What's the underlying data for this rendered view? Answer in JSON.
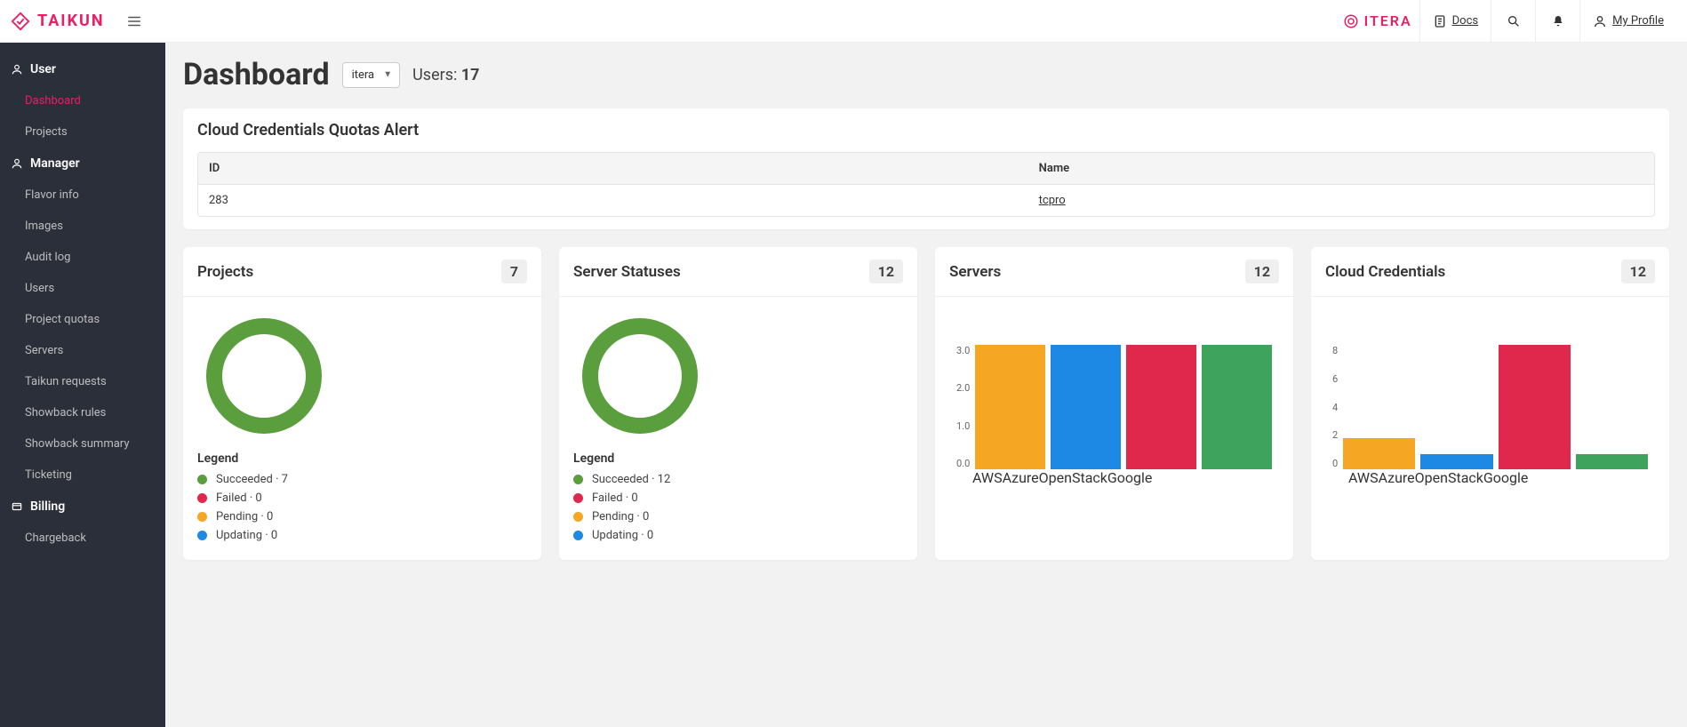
{
  "brand": {
    "name": "TAIKUN"
  },
  "header": {
    "org_label": "ITERA",
    "docs": "Docs",
    "profile": "My Profile"
  },
  "sidebar": {
    "user_section": "User",
    "manager_section": "Manager",
    "billing_section": "Billing",
    "items": {
      "dashboard": "Dashboard",
      "projects": "Projects",
      "flavor_info": "Flavor info",
      "images": "Images",
      "audit_log": "Audit log",
      "users": "Users",
      "project_quotas": "Project quotas",
      "servers": "Servers",
      "taikun_requests": "Taikun requests",
      "showback_rules": "Showback rules",
      "showback_summary": "Showback summary",
      "ticketing": "Ticketing",
      "chargeback": "Chargeback"
    }
  },
  "page": {
    "title": "Dashboard",
    "org_selected": "itera",
    "users_label": "Users:",
    "users_count": "17"
  },
  "alert": {
    "title": "Cloud Credentials Quotas Alert",
    "columns": {
      "id": "ID",
      "name": "Name"
    },
    "row": {
      "id": "283",
      "name": "tcpro"
    }
  },
  "panels": {
    "projects": {
      "title": "Projects",
      "count": "7"
    },
    "server_statuses": {
      "title": "Server Statuses",
      "count": "12"
    },
    "servers": {
      "title": "Servers",
      "count": "12"
    },
    "cloud_creds": {
      "title": "Cloud Credentials",
      "count": "12"
    }
  },
  "legend": {
    "title": "Legend",
    "projects": {
      "succeeded": "Succeeded · 7",
      "failed": "Failed · 0",
      "pending": "Pending · 0",
      "updating": "Updating · 0"
    },
    "servers": {
      "succeeded": "Succeeded · 12",
      "failed": "Failed · 0",
      "pending": "Pending · 0",
      "updating": "Updating · 0"
    }
  },
  "chart_data": [
    {
      "id": "servers_bar",
      "type": "bar",
      "categories": [
        "AWS",
        "Azure",
        "OpenStack",
        "Google"
      ],
      "values": [
        3,
        3,
        3,
        3
      ],
      "ylim": [
        0,
        3
      ],
      "yticks": [
        "0.0",
        "1.0",
        "2.0",
        "3.0"
      ]
    },
    {
      "id": "creds_bar",
      "type": "bar",
      "categories": [
        "AWS",
        "Azure",
        "OpenStack",
        "Google"
      ],
      "values": [
        2,
        1,
        8,
        1
      ],
      "ylim": [
        0,
        8
      ],
      "yticks": [
        "0",
        "2",
        "4",
        "6",
        "8"
      ]
    }
  ]
}
